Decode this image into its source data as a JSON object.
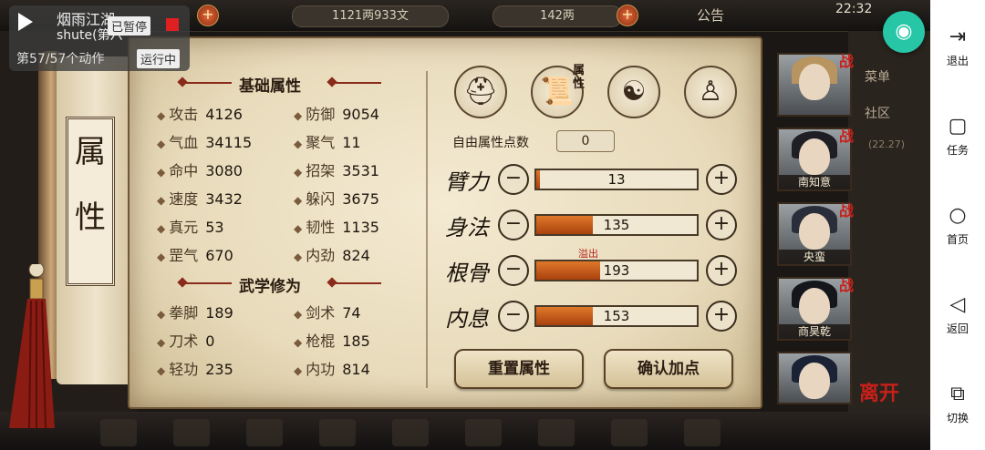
{
  "overlay": {
    "title": "烟雨江湖",
    "subtitle": "shute(第六",
    "paused": "已暂停",
    "progress": "第57/57个动作",
    "status": "运行中"
  },
  "topbar": {
    "currency1": "1121两933文",
    "currency2": "142两",
    "notice": "公告",
    "time": "22:32"
  },
  "scroll_title": [
    "属",
    "性"
  ],
  "basic": {
    "title": "基础属性",
    "stats": [
      {
        "label": "攻击",
        "value": "4126"
      },
      {
        "label": "防御",
        "value": "9054"
      },
      {
        "label": "气血",
        "value": "34115"
      },
      {
        "label": "聚气",
        "value": "11"
      },
      {
        "label": "命中",
        "value": "3080"
      },
      {
        "label": "招架",
        "value": "3531"
      },
      {
        "label": "速度",
        "value": "3432"
      },
      {
        "label": "躲闪",
        "value": "3675"
      },
      {
        "label": "真元",
        "value": "53"
      },
      {
        "label": "韧性",
        "value": "1135"
      },
      {
        "label": "罡气",
        "value": "670"
      },
      {
        "label": "内劲",
        "value": "824"
      }
    ]
  },
  "martial": {
    "title": "武学修为",
    "stats": [
      {
        "label": "拳脚",
        "value": "189"
      },
      {
        "label": "剑术",
        "value": "74"
      },
      {
        "label": "刀术",
        "value": "0"
      },
      {
        "label": "枪棍",
        "value": "185"
      },
      {
        "label": "轻功",
        "value": "235"
      },
      {
        "label": "内功",
        "value": "814"
      }
    ]
  },
  "tabs": {
    "attr_tab_label": "属性"
  },
  "free_points": {
    "label": "自由属性点数",
    "value": "0"
  },
  "attributes": [
    {
      "name": "臂力",
      "value": "13",
      "fill": 0.02
    },
    {
      "name": "身法",
      "value": "135",
      "fill": 0.35
    },
    {
      "name": "根骨",
      "value": "193",
      "fill": 0.4
    },
    {
      "name": "内息",
      "value": "153",
      "fill": 0.35
    }
  ],
  "overflow_label": "溢出",
  "buttons": {
    "reset": "重置属性",
    "confirm": "确认加点"
  },
  "party": [
    {
      "name": "",
      "tag": "战"
    },
    {
      "name": "南知意",
      "tag": "战"
    },
    {
      "name": "央蛮",
      "tag": "战"
    },
    {
      "name": "商昊乾",
      "tag": "战"
    },
    {
      "name": "",
      "tag": ""
    }
  ],
  "leave_label": "离开",
  "side_menu": {
    "menu": "菜单",
    "community": "社区",
    "stamp": "(22.27)"
  },
  "system": {
    "exit": "退出",
    "task": "任务",
    "home": "首页",
    "back": "返回",
    "switch": "切换"
  }
}
